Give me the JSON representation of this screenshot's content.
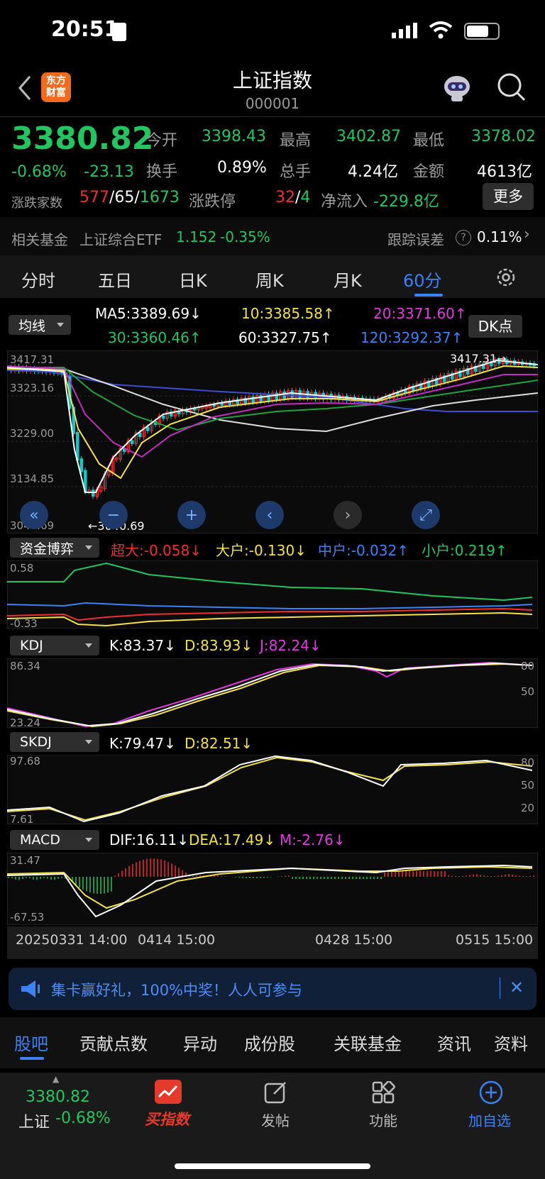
{
  "status": {
    "time": "20:51"
  },
  "header": {
    "logo": "东方\n财富",
    "title": "上证指数",
    "code": "000001"
  },
  "quote": {
    "price": "3380.82",
    "pct": "-0.68%",
    "chg": "-23.13",
    "open_l": "今开",
    "open": "3398.43",
    "high_l": "最高",
    "high": "3402.87",
    "low_l": "最低",
    "low": "3378.02",
    "turn_l": "换手",
    "turn": "0.89%",
    "vol_l": "总手",
    "vol": "4.24亿",
    "amt_l": "金额",
    "amt": "4613亿",
    "adv_l": "涨跌家数",
    "adv_up": "577",
    "adv_flat": "65",
    "adv_down": "1673",
    "limit_l": "涨跌停",
    "limit_up": "32",
    "limit_down": "4",
    "flow_l": "净流入",
    "flow": "-229.8亿",
    "more": "更多"
  },
  "fund": {
    "label": "相关基金",
    "name": "上证综合ETF",
    "price": "1.152",
    "pct": "-0.35%",
    "track_l": "跟踪误差",
    "track": "0.11%"
  },
  "periods": [
    "分时",
    "五日",
    "日K",
    "周K",
    "月K",
    "60分"
  ],
  "ma": {
    "selector": "均线",
    "ma5": "MA5:3389.69",
    "ma10": "10:3385.58",
    "ma20": "20:3371.60",
    "ma30": "30:3360.46",
    "ma60": "60:3327.75",
    "ma120": "120:3292.37",
    "dk": "DK点"
  },
  "price_axis": {
    "top": "3417.31",
    "t2": "3323.16",
    "t3": "3229.00",
    "t4": "3134.85",
    "bottom": "3040.69",
    "max_tag": "3417.31",
    "min_tag": "3040.69"
  },
  "flow_ind": {
    "selector": "资金博弈",
    "xl": "超大:-0.058",
    "l": "大户:-0.130",
    "md": "中户:-0.032",
    "s": "小户:0.219",
    "top": "0.58",
    "bottom": "-0.33"
  },
  "kdj": {
    "selector": "KDJ",
    "k": "K:83.37",
    "d": "D:83.93",
    "j": "J:82.24",
    "top": "86.34",
    "bottom": "23.24",
    "r80": "80",
    "r50": "50"
  },
  "skdj": {
    "selector": "SKDJ",
    "k": "K:79.47",
    "d": "D:82.51",
    "top": "97.68",
    "bottom": "7.61",
    "r80": "80",
    "r50": "50",
    "r20": "20"
  },
  "macd": {
    "selector": "MACD",
    "dif": "DIF:16.11",
    "dea": "DEA:17.49",
    "m": "M:-2.76",
    "top": "31.47",
    "bottom": "-67.53"
  },
  "dates": [
    "20250331 14:00",
    "0414 15:00",
    "0428 15:00",
    "0515 15:00"
  ],
  "banner": {
    "text": "集卡赢好礼，100%中奖！人人可参与"
  },
  "subtabs": [
    "股吧",
    "贡献点数",
    "异动",
    "成份股",
    "关联基金",
    "资讯",
    "资料"
  ],
  "bottom": {
    "price": "3380.82",
    "name": "上证",
    "pct": "-0.68%",
    "buy": "买指数",
    "post": "发帖",
    "func": "功能",
    "add": "加自选"
  },
  "chart_data": {
    "type": "candlestick",
    "title": "上证指数 60分",
    "ylim": [
      3040.69,
      3417.31
    ],
    "x": [
      "20250331 14:00",
      "0414 15:00",
      "0428 15:00",
      "0515 15:00"
    ],
    "extremes": {
      "high": 3417.31,
      "low": 3040.69
    }
  }
}
